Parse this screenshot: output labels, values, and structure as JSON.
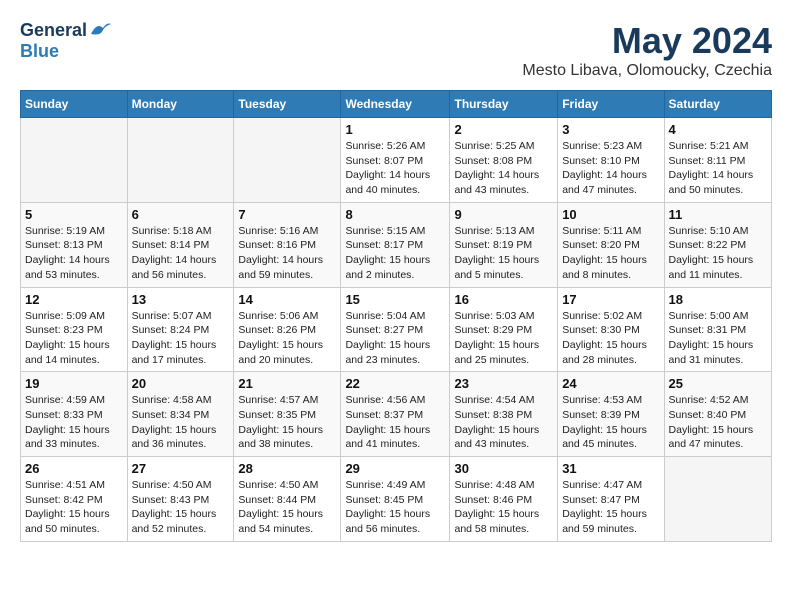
{
  "header": {
    "logo_general": "General",
    "logo_blue": "Blue",
    "month_year": "May 2024",
    "location": "Mesto Libava, Olomoucky, Czechia"
  },
  "days_of_week": [
    "Sunday",
    "Monday",
    "Tuesday",
    "Wednesday",
    "Thursday",
    "Friday",
    "Saturday"
  ],
  "weeks": [
    [
      {
        "day": "",
        "info": ""
      },
      {
        "day": "",
        "info": ""
      },
      {
        "day": "",
        "info": ""
      },
      {
        "day": "1",
        "info": "Sunrise: 5:26 AM\nSunset: 8:07 PM\nDaylight: 14 hours\nand 40 minutes."
      },
      {
        "day": "2",
        "info": "Sunrise: 5:25 AM\nSunset: 8:08 PM\nDaylight: 14 hours\nand 43 minutes."
      },
      {
        "day": "3",
        "info": "Sunrise: 5:23 AM\nSunset: 8:10 PM\nDaylight: 14 hours\nand 47 minutes."
      },
      {
        "day": "4",
        "info": "Sunrise: 5:21 AM\nSunset: 8:11 PM\nDaylight: 14 hours\nand 50 minutes."
      }
    ],
    [
      {
        "day": "5",
        "info": "Sunrise: 5:19 AM\nSunset: 8:13 PM\nDaylight: 14 hours\nand 53 minutes."
      },
      {
        "day": "6",
        "info": "Sunrise: 5:18 AM\nSunset: 8:14 PM\nDaylight: 14 hours\nand 56 minutes."
      },
      {
        "day": "7",
        "info": "Sunrise: 5:16 AM\nSunset: 8:16 PM\nDaylight: 14 hours\nand 59 minutes."
      },
      {
        "day": "8",
        "info": "Sunrise: 5:15 AM\nSunset: 8:17 PM\nDaylight: 15 hours\nand 2 minutes."
      },
      {
        "day": "9",
        "info": "Sunrise: 5:13 AM\nSunset: 8:19 PM\nDaylight: 15 hours\nand 5 minutes."
      },
      {
        "day": "10",
        "info": "Sunrise: 5:11 AM\nSunset: 8:20 PM\nDaylight: 15 hours\nand 8 minutes."
      },
      {
        "day": "11",
        "info": "Sunrise: 5:10 AM\nSunset: 8:22 PM\nDaylight: 15 hours\nand 11 minutes."
      }
    ],
    [
      {
        "day": "12",
        "info": "Sunrise: 5:09 AM\nSunset: 8:23 PM\nDaylight: 15 hours\nand 14 minutes."
      },
      {
        "day": "13",
        "info": "Sunrise: 5:07 AM\nSunset: 8:24 PM\nDaylight: 15 hours\nand 17 minutes."
      },
      {
        "day": "14",
        "info": "Sunrise: 5:06 AM\nSunset: 8:26 PM\nDaylight: 15 hours\nand 20 minutes."
      },
      {
        "day": "15",
        "info": "Sunrise: 5:04 AM\nSunset: 8:27 PM\nDaylight: 15 hours\nand 23 minutes."
      },
      {
        "day": "16",
        "info": "Sunrise: 5:03 AM\nSunset: 8:29 PM\nDaylight: 15 hours\nand 25 minutes."
      },
      {
        "day": "17",
        "info": "Sunrise: 5:02 AM\nSunset: 8:30 PM\nDaylight: 15 hours\nand 28 minutes."
      },
      {
        "day": "18",
        "info": "Sunrise: 5:00 AM\nSunset: 8:31 PM\nDaylight: 15 hours\nand 31 minutes."
      }
    ],
    [
      {
        "day": "19",
        "info": "Sunrise: 4:59 AM\nSunset: 8:33 PM\nDaylight: 15 hours\nand 33 minutes."
      },
      {
        "day": "20",
        "info": "Sunrise: 4:58 AM\nSunset: 8:34 PM\nDaylight: 15 hours\nand 36 minutes."
      },
      {
        "day": "21",
        "info": "Sunrise: 4:57 AM\nSunset: 8:35 PM\nDaylight: 15 hours\nand 38 minutes."
      },
      {
        "day": "22",
        "info": "Sunrise: 4:56 AM\nSunset: 8:37 PM\nDaylight: 15 hours\nand 41 minutes."
      },
      {
        "day": "23",
        "info": "Sunrise: 4:54 AM\nSunset: 8:38 PM\nDaylight: 15 hours\nand 43 minutes."
      },
      {
        "day": "24",
        "info": "Sunrise: 4:53 AM\nSunset: 8:39 PM\nDaylight: 15 hours\nand 45 minutes."
      },
      {
        "day": "25",
        "info": "Sunrise: 4:52 AM\nSunset: 8:40 PM\nDaylight: 15 hours\nand 47 minutes."
      }
    ],
    [
      {
        "day": "26",
        "info": "Sunrise: 4:51 AM\nSunset: 8:42 PM\nDaylight: 15 hours\nand 50 minutes."
      },
      {
        "day": "27",
        "info": "Sunrise: 4:50 AM\nSunset: 8:43 PM\nDaylight: 15 hours\nand 52 minutes."
      },
      {
        "day": "28",
        "info": "Sunrise: 4:50 AM\nSunset: 8:44 PM\nDaylight: 15 hours\nand 54 minutes."
      },
      {
        "day": "29",
        "info": "Sunrise: 4:49 AM\nSunset: 8:45 PM\nDaylight: 15 hours\nand 56 minutes."
      },
      {
        "day": "30",
        "info": "Sunrise: 4:48 AM\nSunset: 8:46 PM\nDaylight: 15 hours\nand 58 minutes."
      },
      {
        "day": "31",
        "info": "Sunrise: 4:47 AM\nSunset: 8:47 PM\nDaylight: 15 hours\nand 59 minutes."
      },
      {
        "day": "",
        "info": ""
      }
    ]
  ]
}
